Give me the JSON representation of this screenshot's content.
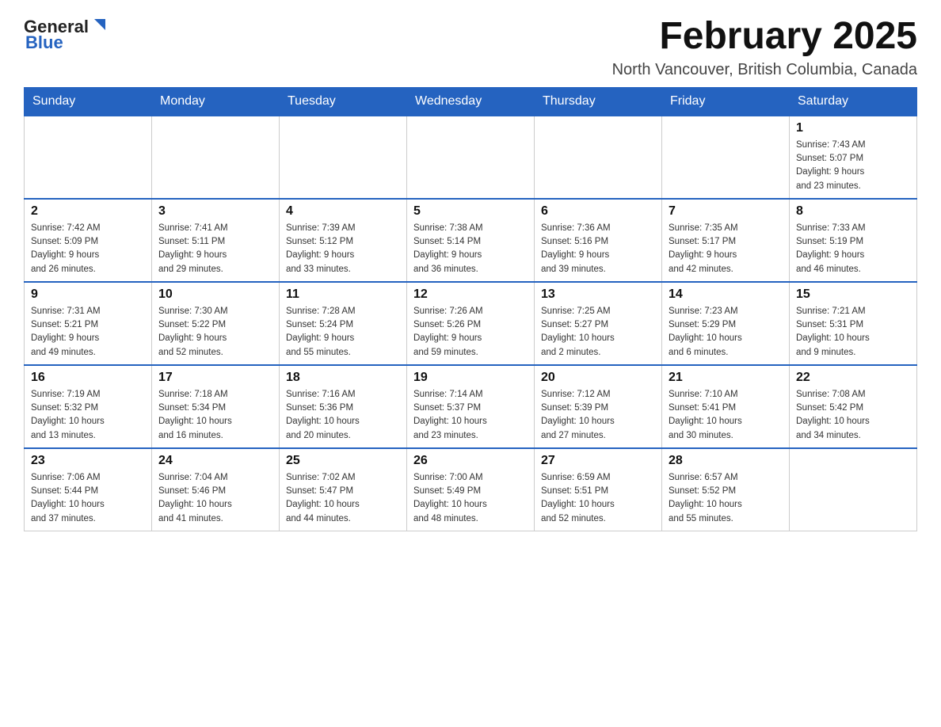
{
  "header": {
    "logo_general": "General",
    "logo_blue": "Blue",
    "month_title": "February 2025",
    "location": "North Vancouver, British Columbia, Canada"
  },
  "weekdays": [
    "Sunday",
    "Monday",
    "Tuesday",
    "Wednesday",
    "Thursday",
    "Friday",
    "Saturday"
  ],
  "weeks": [
    [
      {
        "day": "",
        "info": ""
      },
      {
        "day": "",
        "info": ""
      },
      {
        "day": "",
        "info": ""
      },
      {
        "day": "",
        "info": ""
      },
      {
        "day": "",
        "info": ""
      },
      {
        "day": "",
        "info": ""
      },
      {
        "day": "1",
        "info": "Sunrise: 7:43 AM\nSunset: 5:07 PM\nDaylight: 9 hours\nand 23 minutes."
      }
    ],
    [
      {
        "day": "2",
        "info": "Sunrise: 7:42 AM\nSunset: 5:09 PM\nDaylight: 9 hours\nand 26 minutes."
      },
      {
        "day": "3",
        "info": "Sunrise: 7:41 AM\nSunset: 5:11 PM\nDaylight: 9 hours\nand 29 minutes."
      },
      {
        "day": "4",
        "info": "Sunrise: 7:39 AM\nSunset: 5:12 PM\nDaylight: 9 hours\nand 33 minutes."
      },
      {
        "day": "5",
        "info": "Sunrise: 7:38 AM\nSunset: 5:14 PM\nDaylight: 9 hours\nand 36 minutes."
      },
      {
        "day": "6",
        "info": "Sunrise: 7:36 AM\nSunset: 5:16 PM\nDaylight: 9 hours\nand 39 minutes."
      },
      {
        "day": "7",
        "info": "Sunrise: 7:35 AM\nSunset: 5:17 PM\nDaylight: 9 hours\nand 42 minutes."
      },
      {
        "day": "8",
        "info": "Sunrise: 7:33 AM\nSunset: 5:19 PM\nDaylight: 9 hours\nand 46 minutes."
      }
    ],
    [
      {
        "day": "9",
        "info": "Sunrise: 7:31 AM\nSunset: 5:21 PM\nDaylight: 9 hours\nand 49 minutes."
      },
      {
        "day": "10",
        "info": "Sunrise: 7:30 AM\nSunset: 5:22 PM\nDaylight: 9 hours\nand 52 minutes."
      },
      {
        "day": "11",
        "info": "Sunrise: 7:28 AM\nSunset: 5:24 PM\nDaylight: 9 hours\nand 55 minutes."
      },
      {
        "day": "12",
        "info": "Sunrise: 7:26 AM\nSunset: 5:26 PM\nDaylight: 9 hours\nand 59 minutes."
      },
      {
        "day": "13",
        "info": "Sunrise: 7:25 AM\nSunset: 5:27 PM\nDaylight: 10 hours\nand 2 minutes."
      },
      {
        "day": "14",
        "info": "Sunrise: 7:23 AM\nSunset: 5:29 PM\nDaylight: 10 hours\nand 6 minutes."
      },
      {
        "day": "15",
        "info": "Sunrise: 7:21 AM\nSunset: 5:31 PM\nDaylight: 10 hours\nand 9 minutes."
      }
    ],
    [
      {
        "day": "16",
        "info": "Sunrise: 7:19 AM\nSunset: 5:32 PM\nDaylight: 10 hours\nand 13 minutes."
      },
      {
        "day": "17",
        "info": "Sunrise: 7:18 AM\nSunset: 5:34 PM\nDaylight: 10 hours\nand 16 minutes."
      },
      {
        "day": "18",
        "info": "Sunrise: 7:16 AM\nSunset: 5:36 PM\nDaylight: 10 hours\nand 20 minutes."
      },
      {
        "day": "19",
        "info": "Sunrise: 7:14 AM\nSunset: 5:37 PM\nDaylight: 10 hours\nand 23 minutes."
      },
      {
        "day": "20",
        "info": "Sunrise: 7:12 AM\nSunset: 5:39 PM\nDaylight: 10 hours\nand 27 minutes."
      },
      {
        "day": "21",
        "info": "Sunrise: 7:10 AM\nSunset: 5:41 PM\nDaylight: 10 hours\nand 30 minutes."
      },
      {
        "day": "22",
        "info": "Sunrise: 7:08 AM\nSunset: 5:42 PM\nDaylight: 10 hours\nand 34 minutes."
      }
    ],
    [
      {
        "day": "23",
        "info": "Sunrise: 7:06 AM\nSunset: 5:44 PM\nDaylight: 10 hours\nand 37 minutes."
      },
      {
        "day": "24",
        "info": "Sunrise: 7:04 AM\nSunset: 5:46 PM\nDaylight: 10 hours\nand 41 minutes."
      },
      {
        "day": "25",
        "info": "Sunrise: 7:02 AM\nSunset: 5:47 PM\nDaylight: 10 hours\nand 44 minutes."
      },
      {
        "day": "26",
        "info": "Sunrise: 7:00 AM\nSunset: 5:49 PM\nDaylight: 10 hours\nand 48 minutes."
      },
      {
        "day": "27",
        "info": "Sunrise: 6:59 AM\nSunset: 5:51 PM\nDaylight: 10 hours\nand 52 minutes."
      },
      {
        "day": "28",
        "info": "Sunrise: 6:57 AM\nSunset: 5:52 PM\nDaylight: 10 hours\nand 55 minutes."
      },
      {
        "day": "",
        "info": ""
      }
    ]
  ]
}
